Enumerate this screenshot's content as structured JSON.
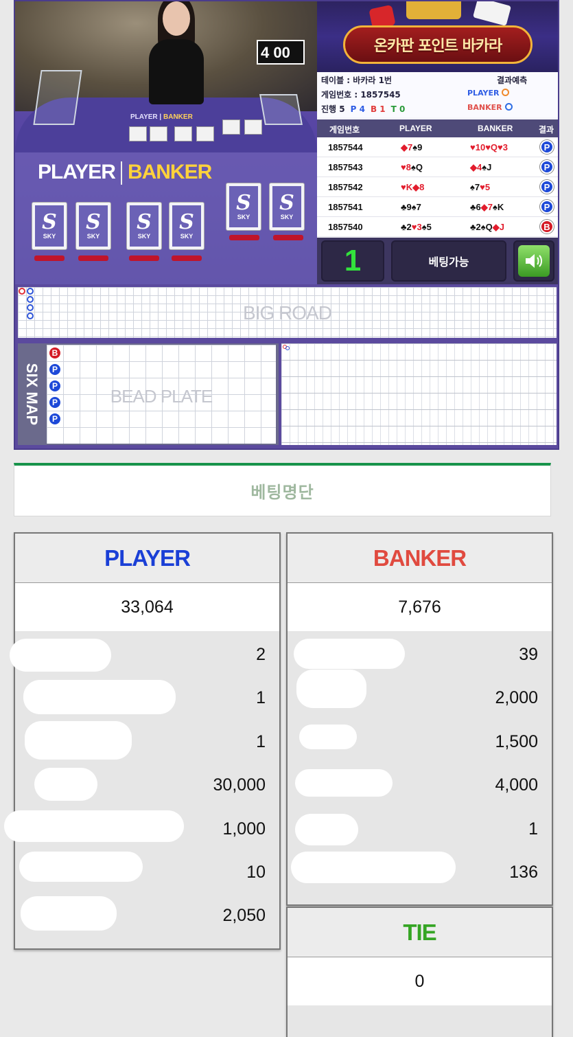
{
  "video": {
    "timer": "4 00",
    "mini_player": "PLAYER",
    "mini_banker": "BANKER",
    "board_player": "PLAYER",
    "board_banker": "BANKER",
    "card_brand": "SKY"
  },
  "banner": {
    "title": "온카판 포인트 바카라"
  },
  "table_info": {
    "table_label": "테이블 : 바카라 1번",
    "game_no_label": "게임번호 : 1857545",
    "progress_label": "진행 5",
    "progress_p": "P 4",
    "progress_b": "B 1",
    "progress_t": "T 0",
    "prediction_label": "결과예측",
    "prediction_player": "PLAYER",
    "prediction_banker": "BANKER"
  },
  "history": {
    "headers": [
      "게임번호",
      "PLAYER",
      "BANKER",
      "결과"
    ],
    "rows": [
      {
        "no": "1857544",
        "player": [
          {
            "t": "◆7",
            "r": true
          },
          {
            "t": "♠9",
            "r": false
          }
        ],
        "banker": [
          {
            "t": "♥10",
            "r": true
          },
          {
            "t": "♥Q",
            "r": true
          },
          {
            "t": "♥3",
            "r": true
          }
        ],
        "result": "P"
      },
      {
        "no": "1857543",
        "player": [
          {
            "t": "♥8",
            "r": true
          },
          {
            "t": "♠Q",
            "r": false
          }
        ],
        "banker": [
          {
            "t": "◆4",
            "r": true
          },
          {
            "t": "♠J",
            "r": false
          }
        ],
        "result": "P"
      },
      {
        "no": "1857542",
        "player": [
          {
            "t": "♥K",
            "r": true
          },
          {
            "t": "◆8",
            "r": true
          }
        ],
        "banker": [
          {
            "t": "♠7",
            "r": false
          },
          {
            "t": "♥5",
            "r": true
          }
        ],
        "result": "P"
      },
      {
        "no": "1857541",
        "player": [
          {
            "t": "♣9",
            "r": false
          },
          {
            "t": "♠7",
            "r": false
          }
        ],
        "banker": [
          {
            "t": "♣6",
            "r": false
          },
          {
            "t": "◆7",
            "r": true
          },
          {
            "t": "♠K",
            "r": false
          }
        ],
        "result": "P"
      },
      {
        "no": "1857540",
        "player": [
          {
            "t": "♣2",
            "r": false
          },
          {
            "t": "♥3",
            "r": true
          },
          {
            "t": "♠5",
            "r": false
          }
        ],
        "banker": [
          {
            "t": "♣2",
            "r": false
          },
          {
            "t": "♠Q",
            "r": false
          },
          {
            "t": "◆J",
            "r": true
          }
        ],
        "result": "B"
      }
    ]
  },
  "controls": {
    "count": "1",
    "status": "베팅가능",
    "sound_icon": "speaker-icon"
  },
  "roads": {
    "big_road": "BIG ROAD",
    "six_map": "SIX MAP",
    "bead_plate": "BEAD PLATE",
    "bead_results": [
      "B",
      "P",
      "P",
      "P",
      "P"
    ]
  },
  "betting_list": {
    "title": "베팅명단"
  },
  "player_col": {
    "title": "PLAYER",
    "color": "#1a3fd6",
    "total": "33,064",
    "values": [
      "2",
      "1",
      "1",
      "30,000",
      "1,000",
      "10",
      "2,050"
    ]
  },
  "banker_col": {
    "title": "BANKER",
    "color": "#e04a3f",
    "total": "7,676",
    "values": [
      "39",
      "2,000",
      "1,500",
      "4,000",
      "1",
      "136"
    ]
  },
  "tie_col": {
    "title": "TIE",
    "color": "#35a524",
    "total": "0"
  }
}
